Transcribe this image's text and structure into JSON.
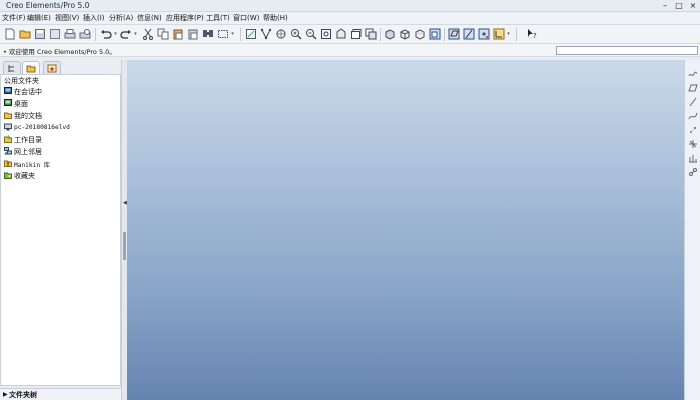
{
  "window": {
    "title": "Creo Elements/Pro 5.0",
    "controls": [
      "minimize",
      "maximize",
      "close"
    ]
  },
  "menu": [
    "文件(F)",
    "编辑(E)",
    "视图(V)",
    "插入(I)",
    "分析(A)",
    "信息(N)",
    "应用程序(P)",
    "工具(T)",
    "窗口(W)",
    "帮助(H)"
  ],
  "toolbar": {
    "icons": [
      "new-file-icon",
      "open-folder-icon",
      "save-icon",
      "save-copy-icon",
      "print-icon",
      "print-preview-icon",
      "mail-icon",
      "undo-icon",
      "redo-icon",
      "cut-icon",
      "copy-icon",
      "paste-icon",
      "paste-special-icon",
      "find-icon",
      "select-box-icon",
      "regenerate-icon",
      "orient-icon",
      "spin-icon",
      "zoom-in-icon",
      "zoom-out-icon",
      "refit-icon",
      "reorient-icon",
      "saved-views-icon",
      "layers-icon",
      "shading-icon",
      "wireframe-icon",
      "hidden-line-icon",
      "no-hidden-icon",
      "datum-planes-icon",
      "datum-axes-icon",
      "datum-points-icon",
      "coordinate-systems-icon",
      "whats-this-icon"
    ]
  },
  "status": {
    "message": "欢迎使用 Creo Elements/Pro 5.0。",
    "command_value": ""
  },
  "navigator": {
    "tabs": [
      "model-tree-tab",
      "folder-browser-tab",
      "favorites-tab"
    ],
    "active_tab": 1,
    "header": "公用文件夹",
    "items": [
      {
        "label": "在会话中",
        "icon": "in-session-icon"
      },
      {
        "label": "桌面",
        "icon": "desktop-icon"
      },
      {
        "label": "我的文档",
        "icon": "my-documents-icon"
      },
      {
        "label": "pc-20180816elvd",
        "icon": "computer-icon"
      },
      {
        "label": "工作目录",
        "icon": "working-directory-icon"
      },
      {
        "label": "网上邻居",
        "icon": "network-icon"
      },
      {
        "label": "Manikin 库",
        "icon": "manikin-library-icon"
      },
      {
        "label": "收藏夹",
        "icon": "favorites-folder-icon"
      }
    ],
    "footer": "文件夹树"
  },
  "datum_toolbar": {
    "icons": [
      "sketch-datum-icon",
      "datum-plane-icon",
      "datum-axis-icon",
      "datum-curve-icon",
      "datum-point-icon",
      "datum-coord-icon",
      "datum-analysis-icon",
      "datum-csys-icon"
    ]
  },
  "colors": {
    "graphics_top": "#cad9e9",
    "graphics_bottom": "#6584b1"
  }
}
